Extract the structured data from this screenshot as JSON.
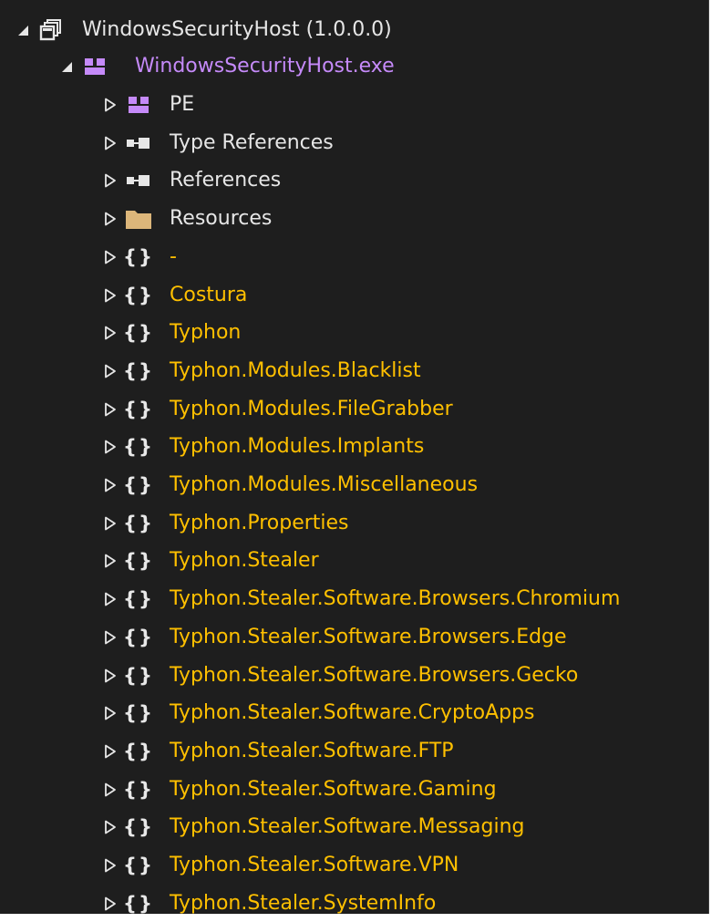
{
  "tree": {
    "assembly": {
      "label": "WindowsSecurityHost (1.0.0.0)",
      "icon": "assembly-icon"
    },
    "module": {
      "label": "WindowsSecurityHost.exe",
      "icon": "module-icon"
    },
    "children": [
      {
        "label": "PE",
        "icon": "module-icon",
        "kind": "pe"
      },
      {
        "label": "Type References",
        "icon": "references-icon",
        "kind": "ref"
      },
      {
        "label": "References",
        "icon": "references-icon",
        "kind": "ref"
      },
      {
        "label": "Resources",
        "icon": "folder-icon",
        "kind": "folder"
      },
      {
        "label": "-",
        "icon": "namespace-icon",
        "kind": "ns"
      },
      {
        "label": "Costura",
        "icon": "namespace-icon",
        "kind": "ns"
      },
      {
        "label": "Typhon",
        "icon": "namespace-icon",
        "kind": "ns"
      },
      {
        "label": "Typhon.Modules.Blacklist",
        "icon": "namespace-icon",
        "kind": "ns"
      },
      {
        "label": "Typhon.Modules.FileGrabber",
        "icon": "namespace-icon",
        "kind": "ns"
      },
      {
        "label": "Typhon.Modules.Implants",
        "icon": "namespace-icon",
        "kind": "ns"
      },
      {
        "label": "Typhon.Modules.Miscellaneous",
        "icon": "namespace-icon",
        "kind": "ns"
      },
      {
        "label": "Typhon.Properties",
        "icon": "namespace-icon",
        "kind": "ns"
      },
      {
        "label": "Typhon.Stealer",
        "icon": "namespace-icon",
        "kind": "ns"
      },
      {
        "label": "Typhon.Stealer.Software.Browsers.Chromium",
        "icon": "namespace-icon",
        "kind": "ns"
      },
      {
        "label": "Typhon.Stealer.Software.Browsers.Edge",
        "icon": "namespace-icon",
        "kind": "ns"
      },
      {
        "label": "Typhon.Stealer.Software.Browsers.Gecko",
        "icon": "namespace-icon",
        "kind": "ns"
      },
      {
        "label": "Typhon.Stealer.Software.CryptoApps",
        "icon": "namespace-icon",
        "kind": "ns"
      },
      {
        "label": "Typhon.Stealer.Software.FTP",
        "icon": "namespace-icon",
        "kind": "ns"
      },
      {
        "label": "Typhon.Stealer.Software.Gaming",
        "icon": "namespace-icon",
        "kind": "ns"
      },
      {
        "label": "Typhon.Stealer.Software.Messaging",
        "icon": "namespace-icon",
        "kind": "ns"
      },
      {
        "label": "Typhon.Stealer.Software.VPN",
        "icon": "namespace-icon",
        "kind": "ns"
      },
      {
        "label": "Typhon.Stealer.SystemInfo",
        "icon": "namespace-icon",
        "kind": "ns"
      }
    ]
  },
  "colors": {
    "background": "#1e1e1e",
    "default_text": "#e6e6e6",
    "module_text": "#c58af9",
    "namespace_text": "#ffc000",
    "folder": "#dcb67a",
    "module_icon": "#c58af9"
  }
}
